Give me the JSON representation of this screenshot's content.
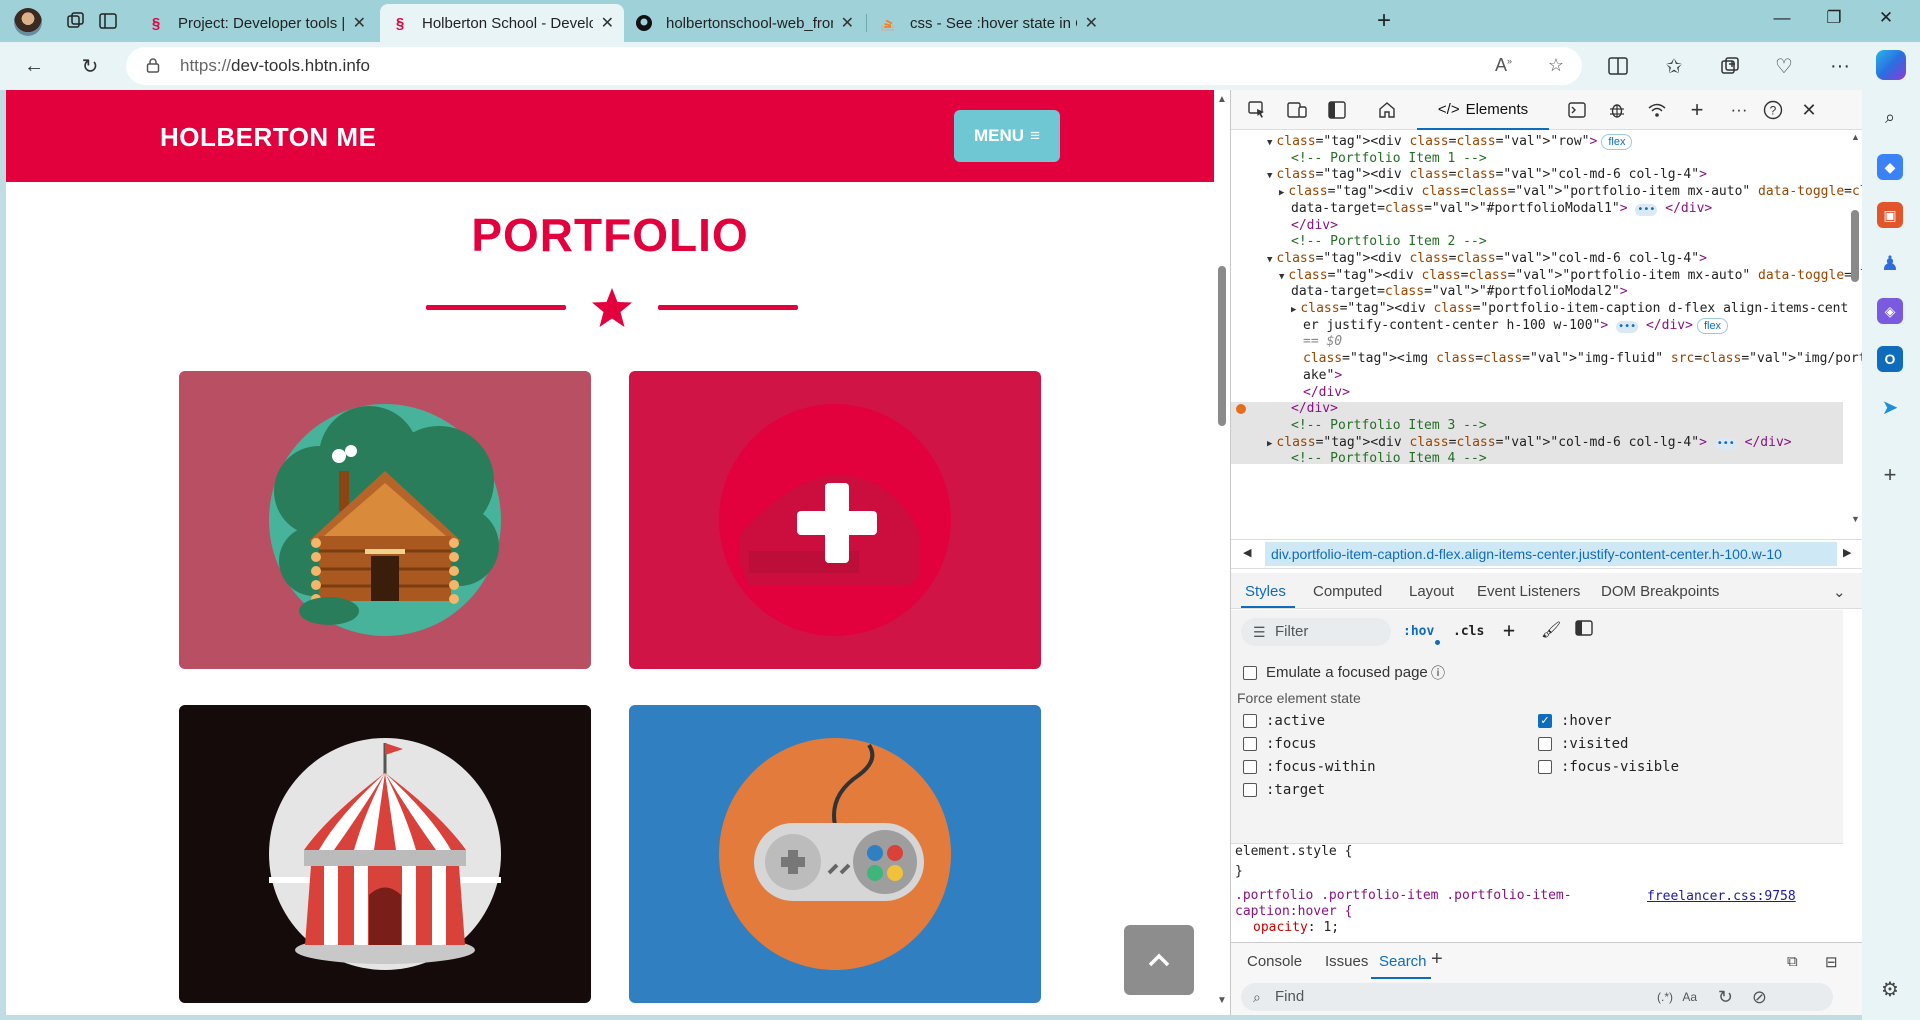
{
  "browser": {
    "tabs": [
      {
        "title": "Project: Developer tools | Holberton",
        "favicon": "holberton-icon"
      },
      {
        "title": "Holberton School - Developer to",
        "favicon": "holberton-icon"
      },
      {
        "title": "holbertonschool-web_front_end/",
        "favicon": "github-icon"
      },
      {
        "title": "css - See :hover state in Chrome",
        "favicon": "stackoverflow-icon"
      }
    ],
    "new_tab_label": "+",
    "url_protocol": "https://",
    "url_host": "dev-tools.hbtn.info"
  },
  "site": {
    "brand": "HOLBERTON ME",
    "menu_label": "MENU",
    "portfolio_title": "PORTFOLIO",
    "scroll_top_icon": "chevron-up-icon",
    "colors": {
      "primary": "#e2003d",
      "accent": "#6ec7d2"
    }
  },
  "devtools": {
    "elements_tab": "Elements",
    "dom_lines": [
      {
        "indent": 2,
        "arrow": "▼",
        "html": "<div class=\"row\">",
        "badge": "flex"
      },
      {
        "indent": 3,
        "arrow": "",
        "comment": "<!-- Portfolio Item 1 -->"
      },
      {
        "indent": 2,
        "arrow": "▼",
        "html": "<div class=\"col-md-6 col-lg-4\">"
      },
      {
        "indent": 3,
        "arrow": "▶",
        "html": "<div class=\"portfolio-item mx-auto\" data-toggle=\"modal\""
      },
      {
        "indent": 3,
        "arrow": "",
        "html": "data-target=\"#portfolioModal1\">",
        "ellipsis": true,
        "close": "</div>"
      },
      {
        "indent": 3,
        "arrow": "",
        "close_only": "</div>"
      },
      {
        "indent": 3,
        "arrow": "",
        "comment": "<!-- Portfolio Item 2 -->"
      },
      {
        "indent": 2,
        "arrow": "▼",
        "html": "<div class=\"col-md-6 col-lg-4\">"
      },
      {
        "indent": 3,
        "arrow": "▼",
        "html": "<div class=\"portfolio-item mx-auto\" data-toggle=\"modal\""
      },
      {
        "indent": 3,
        "arrow": "",
        "html": "data-target=\"#portfolioModal2\">"
      },
      {
        "indent": 4,
        "arrow": "▶",
        "html": "<div class=\"portfolio-item-caption d-flex align-items-cent"
      },
      {
        "indent": 4,
        "arrow": "",
        "html": "er justify-content-center h-100 w-100\">",
        "ellipsis": true,
        "close": "</div>",
        "badge": "flex"
      },
      {
        "indent": 4,
        "arrow": "",
        "eq": "== $0"
      },
      {
        "indent": 4,
        "arrow": "",
        "html": "<img class=\"img-fluid\" src=\"img/portfolio/cake.png\" alt=\"c"
      },
      {
        "indent": 4,
        "arrow": "",
        "html": "ake\">"
      },
      {
        "indent": 4,
        "arrow": "",
        "close_only": "</div>"
      },
      {
        "indent": 3,
        "arrow": "",
        "close_only": "</div>"
      },
      {
        "indent": 3,
        "arrow": "",
        "comment": "<!-- Portfolio Item 3 -->"
      },
      {
        "indent": 2,
        "arrow": "▶",
        "html": "<div class=\"col-md-6 col-lg-4\">",
        "ellipsis": true,
        "close": "</div>"
      },
      {
        "indent": 3,
        "arrow": "",
        "comment": "<!-- Portfolio Item 4 -->"
      }
    ],
    "breadcrumb": "div.portfolio-item-caption.d-flex.align-items-center.justify-content-center.h-100.w-10",
    "subtabs": [
      "Styles",
      "Computed",
      "Layout",
      "Event Listeners",
      "DOM Breakpoints"
    ],
    "filter_placeholder": "Filter",
    "hov_label": ":hov",
    "cls_label": ".cls",
    "emulate_focused": "Emulate a focused page",
    "force_state_label": "Force element state",
    "states_left": [
      ":active",
      ":focus",
      ":focus-within",
      ":target"
    ],
    "states_right": [
      ":hover",
      ":visited",
      ":focus-visible"
    ],
    "hover_checked": true,
    "css": {
      "element_style_open": "element.style {",
      "element_style_close": "}",
      "rule_selector_1": ".portfolio .portfolio-item .portfolio-item-",
      "rule_selector_2": "caption:hover {",
      "rule_source": "freelancer.css:9758",
      "rule_prop": "opacity",
      "rule_value": "1;"
    },
    "drawer_tabs": [
      "Console",
      "Issues",
      "Search"
    ],
    "find_placeholder": "Find",
    "regex_label": "(.*)",
    "case_label": "Aa"
  }
}
